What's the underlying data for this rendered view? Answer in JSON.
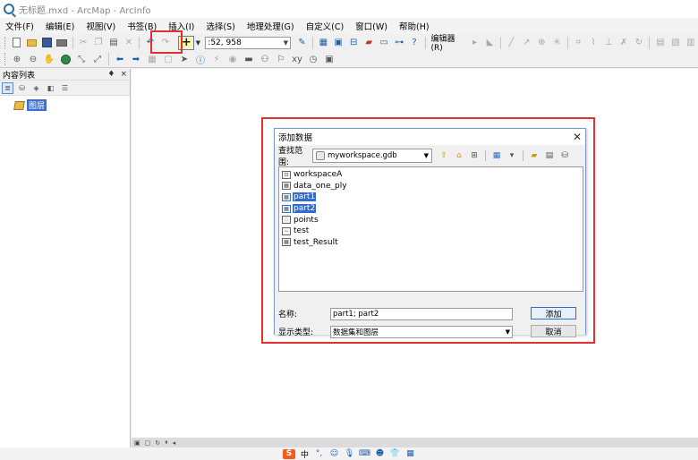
{
  "window": {
    "title": "无标题.mxd - ArcMap - ArcInfo"
  },
  "menu": [
    "文件(F)",
    "编辑(E)",
    "视图(V)",
    "书签(B)",
    "插入(I)",
    "选择(S)",
    "地理处理(G)",
    "自定义(C)",
    "窗口(W)",
    "帮助(H)"
  ],
  "toolbar": {
    "add_data_icon": "plus-icon",
    "scale_value": ":52, 958",
    "editor_label": "编辑器(R)"
  },
  "toc": {
    "title": "内容列表",
    "pin": "♦",
    "close": "×",
    "layer_label": "图层"
  },
  "dialog": {
    "title": "添加数据",
    "close": "✕",
    "look_in_label": "查找范围:",
    "look_in_value": "myworkspace.gdb",
    "items": [
      {
        "name": "workspaceA",
        "icon": "feature-dataset-icon",
        "selected": false
      },
      {
        "name": "data_one_ply",
        "icon": "table-icon",
        "selected": false
      },
      {
        "name": "part1",
        "icon": "table-icon",
        "selected": true
      },
      {
        "name": "part2",
        "icon": "table-icon",
        "selected": true
      },
      {
        "name": "points",
        "icon": "point-feature-class-icon",
        "selected": false
      },
      {
        "name": "test",
        "icon": "line-feature-class-icon",
        "selected": false
      },
      {
        "name": "test_Result",
        "icon": "table-icon",
        "selected": false
      }
    ],
    "name_label": "名称:",
    "name_value": "part1; part2",
    "type_label": "显示类型:",
    "type_value": "数据集和图层",
    "add_button": "添加",
    "cancel_button": "取消"
  },
  "taskbar": {
    "ime_logo": "S",
    "ime_mode": "中"
  },
  "colors": {
    "highlight_red": "#e03030",
    "selection_blue": "#2f6cd0",
    "add_button_yellow": "#fff3b0"
  }
}
